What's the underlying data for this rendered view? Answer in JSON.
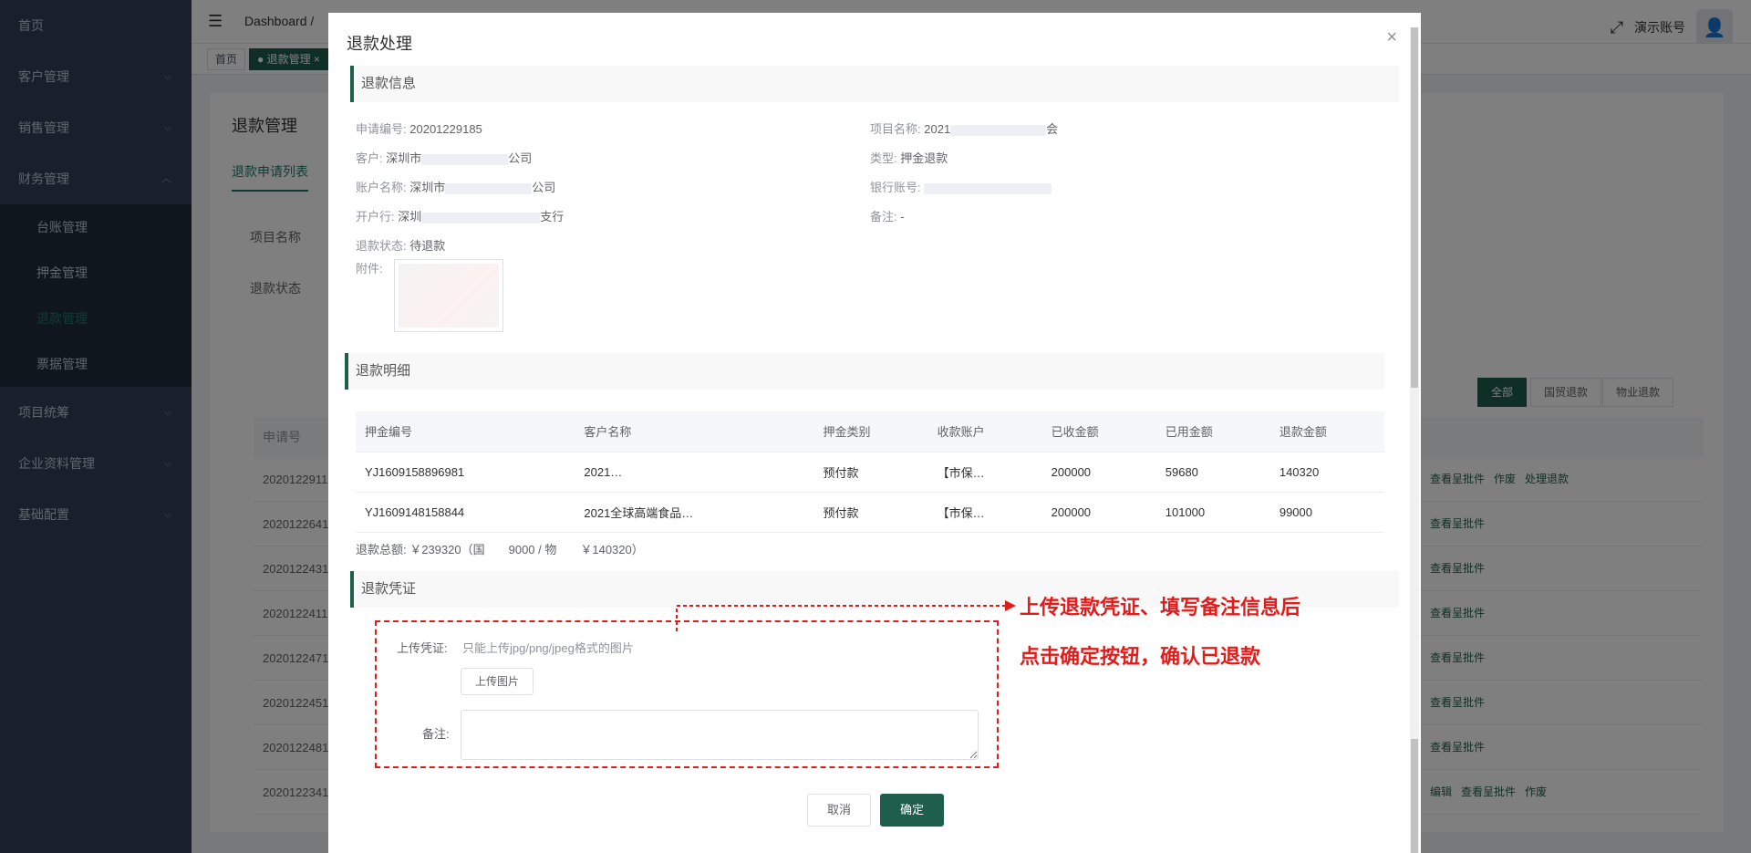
{
  "sidebar": {
    "items": [
      {
        "label": "首页"
      },
      {
        "label": "客户管理"
      },
      {
        "label": "销售管理"
      },
      {
        "label": "财务管理"
      },
      {
        "label": "项目统筹"
      },
      {
        "label": "企业资料管理"
      },
      {
        "label": "基础配置"
      }
    ],
    "finance_sub": [
      {
        "label": "台账管理"
      },
      {
        "label": "押金管理"
      },
      {
        "label": "退款管理"
      },
      {
        "label": "票据管理"
      }
    ]
  },
  "navbar": {
    "breadcrumb": "Dashboard  /",
    "user": "演示账号"
  },
  "tags": {
    "home": "首页",
    "refund": "● 退款管理 ×"
  },
  "bg_page": {
    "title": "退款管理",
    "tab": "退款申请列表",
    "filter_project": "项目名称",
    "filter_status": "退款状态",
    "segments": [
      "全部",
      "国贸退款",
      "物业退款"
    ],
    "column_first": "申请号",
    "rows": [
      {
        "id": "2020122911",
        "actions": [
          "查看呈批件",
          "作废",
          "处理退款"
        ]
      },
      {
        "id": "2020122641",
        "actions": [
          "查看呈批件"
        ]
      },
      {
        "id": "2020122431",
        "actions": [
          "查看呈批件"
        ]
      },
      {
        "id": "2020122411",
        "actions": [
          "查看呈批件"
        ]
      },
      {
        "id": "2020122471",
        "actions": [
          "查看呈批件"
        ]
      },
      {
        "id": "2020122451",
        "actions": [
          "查看呈批件"
        ]
      },
      {
        "id": "2020122481",
        "actions": [
          "查看呈批件"
        ]
      },
      {
        "id": "2020122341",
        "actions": [
          "编辑",
          "查看呈批件",
          "作废"
        ]
      }
    ]
  },
  "dialog": {
    "title": "退款处理",
    "sec_info": "退款信息",
    "info": {
      "apply_no_k": "申请编号:",
      "apply_no_v": "20201229185",
      "project_k": "项目名称:",
      "project_v_a": "2021",
      "project_v_b": "会",
      "customer_k": "客户:",
      "customer_v_a": "深圳市",
      "customer_v_b": "公司",
      "type_k": "类型:",
      "type_v": "押金退款",
      "account_k": "账户名称:",
      "account_v_a": "深圳市",
      "account_v_b": "公司",
      "bank_no_k": "银行账号:",
      "bank_k": "开户行:",
      "bank_v_a": "深圳",
      "bank_v_b": "支行",
      "remark_k": "备注:",
      "remark_v": "-",
      "status_k": "退款状态:",
      "status_v": "待退款",
      "attach_k": "附件:"
    },
    "sec_detail": "退款明细",
    "detail_headers": [
      "押金编号",
      "客户名称",
      "押金类别",
      "收款账户",
      "已收金额",
      "已用金额",
      "退款金额"
    ],
    "detail_rows": [
      [
        "YJ1609158896981",
        "2021…",
        "预付款",
        "【市保…",
        "200000",
        "59680",
        "140320"
      ],
      [
        "YJ1609148158844",
        "2021全球高端食品…",
        "预付款",
        "【市保…",
        "200000",
        "101000",
        "99000"
      ]
    ],
    "total": "退款总额: ￥239320（国　　9000 / 物　　￥140320）",
    "sec_voucher": "退款凭证",
    "upload_label": "上传凭证:",
    "upload_hint": "只能上传jpg/png/jpeg格式的图片",
    "upload_button": "上传图片",
    "remark_label": "备注:",
    "cancel": "取消",
    "confirm": "确定",
    "annotation_1": "上传退款凭证、填写备注信息后",
    "annotation_2": "点击确定按钮，确认已退款"
  }
}
